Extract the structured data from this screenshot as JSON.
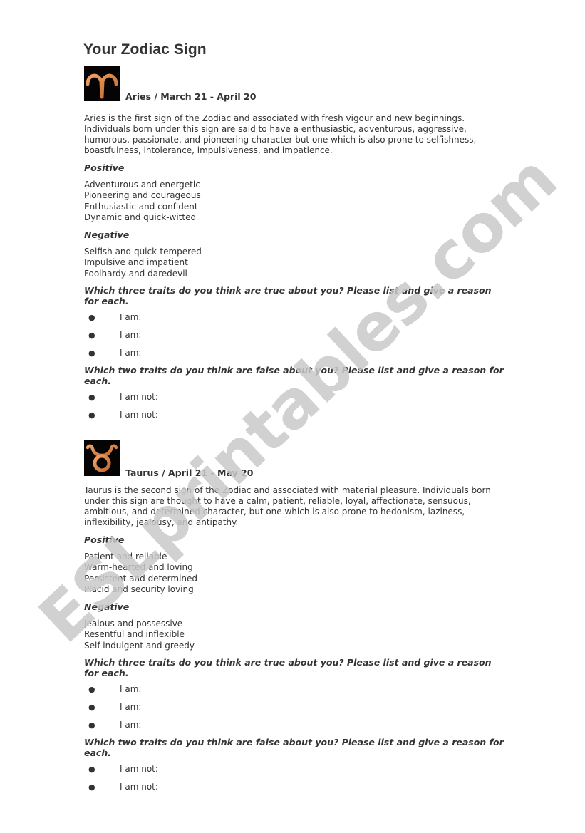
{
  "document": {
    "title": "Your Zodiac Sign",
    "watermark": "ESLprintables.com"
  },
  "signs": [
    {
      "name": "Aries",
      "icon": "aries-symbol",
      "heading": "Aries / March 21 - April 20",
      "description": "Aries is the first sign of the Zodiac and associated with fresh vigour and new beginnings. Individuals born under this sign are said to have a enthusiastic, adventurous, aggressive, humorous, passionate, and pioneering character but one which is also prone to selfishness, boastfulness, intolerance, impulsiveness, and impatience.",
      "positive_label": "Positive",
      "positive": [
        "Adventurous and energetic",
        "Pioneering and courageous",
        "Enthusiastic and confident",
        "Dynamic and quick-witted"
      ],
      "negative_label": "Negative",
      "negative": [
        "Selfish and quick-tempered",
        "Impulsive and impatient",
        "Foolhardy and daredevil"
      ],
      "question_true": "Which three traits do you think are true about you? Please list and give a reason for each.",
      "answers_true": [
        "I am:",
        "I am:",
        "I am:"
      ],
      "question_false": "Which two traits do you think are false about you? Please list and give a reason for each.",
      "answers_false": [
        "I am not:",
        "I am not:"
      ]
    },
    {
      "name": "Taurus",
      "icon": "taurus-symbol",
      "heading": "Taurus / April 21 - May 20",
      "description": "Taurus is the second sign of the Zodiac and associated with material pleasure. Individuals born under this sign are thought to have a calm, patient, reliable, loyal, affectionate, sensuous, ambitious, and determined character, but one which is also prone to hedonism, laziness, inflexibility, jealousy, and antipathy.",
      "positive_label": "Positive",
      "positive": [
        "Patient and reliable",
        "Warm-hearted and loving",
        "Persistent and determined",
        "Placid and security loving"
      ],
      "negative_label": "Negative",
      "negative": [
        "Jealous and possessive",
        "Resentful and inflexible",
        "Self-indulgent and greedy"
      ],
      "question_true": "Which three traits do you think are true about you? Please list and give a reason for each.",
      "answers_true": [
        "I am:",
        "I am:",
        "I am:"
      ],
      "question_false": "Which two traits do you think are false about you? Please list and give a reason for each.",
      "answers_false": [
        "I am not:",
        "I am not:"
      ]
    }
  ],
  "colors": {
    "text": "#333333",
    "icon_background": "#050303",
    "icon_symbol": "#d98a4a",
    "watermark": "#c9c9c9"
  }
}
